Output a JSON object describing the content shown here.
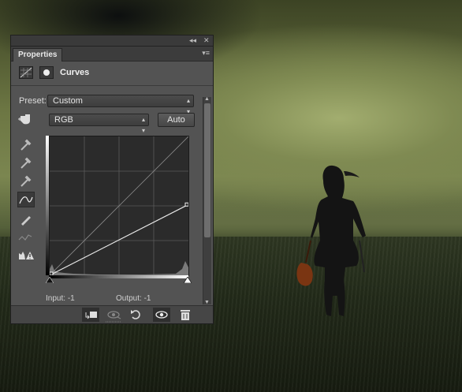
{
  "panel": {
    "tab_label": "Properties",
    "collapse_glyph": "◂◂",
    "close_glyph": "✕",
    "menu_glyph": "▾≡",
    "adjustment_title": "Curves",
    "preset_label": "Preset:",
    "preset_value": "Custom",
    "channel_value": "RGB",
    "auto_label": "Auto",
    "input_label": "Input:",
    "input_value": "-1",
    "output_label": "Output:",
    "output_value": "-1"
  },
  "curve": {
    "channel": "RGB",
    "points": [
      [
        0,
        0
      ],
      [
        255,
        130
      ]
    ],
    "line_color": "#e8e8e8",
    "baseline_color": "#8a8a8a"
  },
  "tools": [
    "target-adjust-icon",
    "black-eyedropper-icon",
    "gray-eyedropper-icon",
    "white-eyedropper-icon",
    "curve-point-icon",
    "pencil-icon",
    "smooth-icon",
    "clipping-warning-icon"
  ],
  "bottom_bar": [
    "clip-to-layer-icon",
    "view-previous-icon",
    "reset-icon",
    "visibility-icon",
    "trash-icon"
  ],
  "colors": {
    "panel": "#535353",
    "panel_dark": "#3a3a3a",
    "accent": "#f0f0f0"
  }
}
